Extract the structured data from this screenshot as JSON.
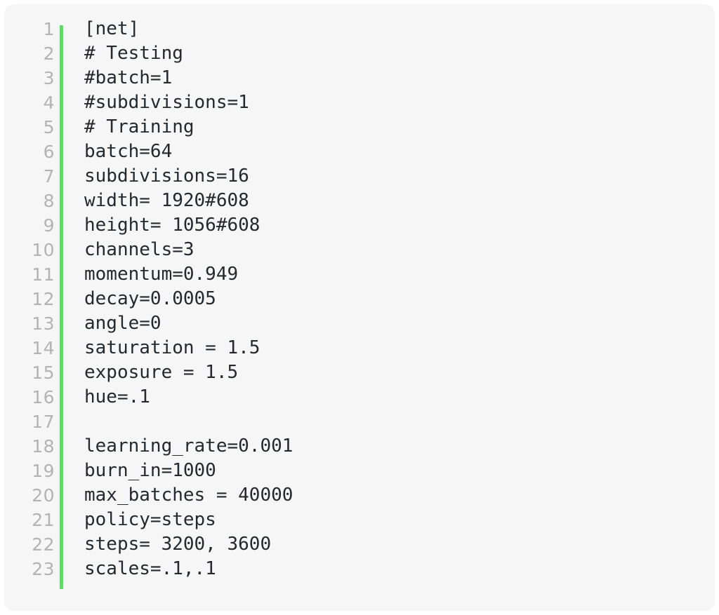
{
  "code_block": {
    "language": "ini",
    "background_color": "#f6f6f6",
    "accent_color": "#5cdf62",
    "line_number_color": "#b3b3b3",
    "text_color": "#24292e",
    "lines": [
      {
        "number": "1",
        "text": "[net]"
      },
      {
        "number": "2",
        "text": "# Testing"
      },
      {
        "number": "3",
        "text": "#batch=1"
      },
      {
        "number": "4",
        "text": "#subdivisions=1"
      },
      {
        "number": "5",
        "text": "# Training"
      },
      {
        "number": "6",
        "text": "batch=64"
      },
      {
        "number": "7",
        "text": "subdivisions=16"
      },
      {
        "number": "8",
        "text": "width= 1920#608"
      },
      {
        "number": "9",
        "text": "height= 1056#608"
      },
      {
        "number": "10",
        "text": "channels=3"
      },
      {
        "number": "11",
        "text": "momentum=0.949"
      },
      {
        "number": "12",
        "text": "decay=0.0005"
      },
      {
        "number": "13",
        "text": "angle=0"
      },
      {
        "number": "14",
        "text": "saturation = 1.5"
      },
      {
        "number": "15",
        "text": "exposure = 1.5"
      },
      {
        "number": "16",
        "text": "hue=.1"
      },
      {
        "number": "17",
        "text": ""
      },
      {
        "number": "18",
        "text": "learning_rate=0.001"
      },
      {
        "number": "19",
        "text": "burn_in=1000"
      },
      {
        "number": "20",
        "text": "max_batches = 40000"
      },
      {
        "number": "21",
        "text": "policy=steps"
      },
      {
        "number": "22",
        "text": "steps= 3200, 3600"
      },
      {
        "number": "23",
        "text": "scales=.1,.1"
      }
    ]
  }
}
